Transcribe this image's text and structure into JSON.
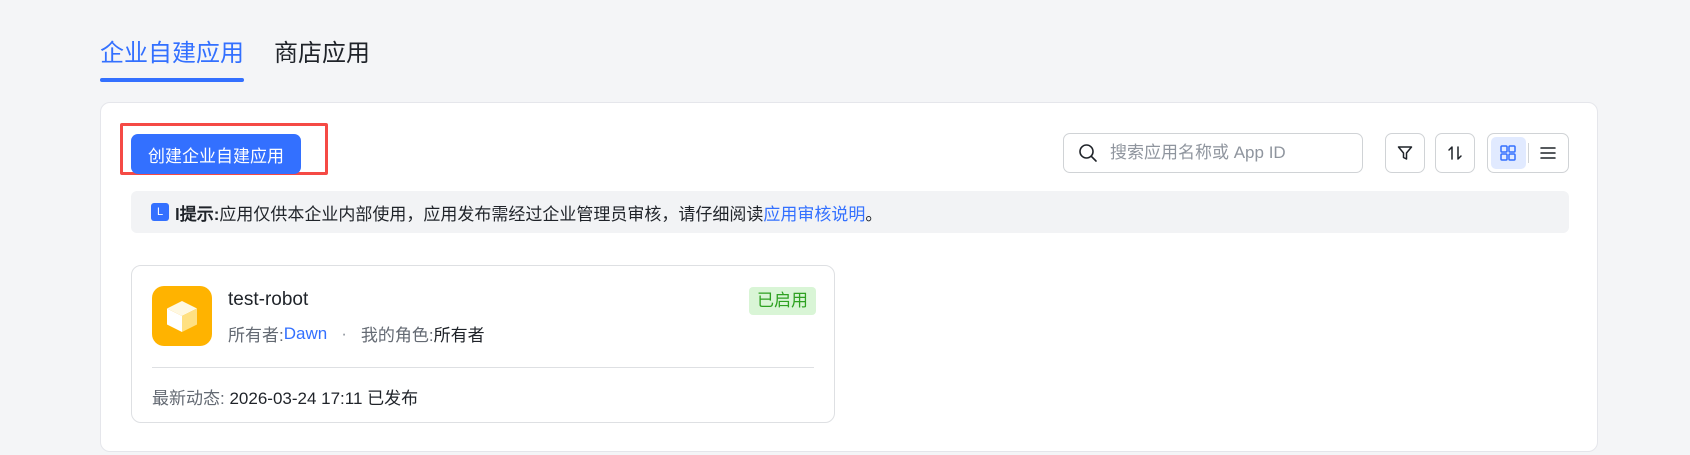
{
  "tabs": [
    {
      "label": "企业自建应用",
      "active": true
    },
    {
      "label": "商店应用",
      "active": false
    }
  ],
  "toolbar": {
    "create_label": "创建企业自建应用",
    "search_placeholder": "搜索应用名称或 App ID",
    "filter_icon": "filter-icon",
    "sort_icon": "sort-icon",
    "grid_view_icon": "grid-view-icon",
    "list_view_icon": "list-view-icon"
  },
  "notice": {
    "icon_text": "L",
    "title": "l提示:",
    "text": " 应用仅供本企业内部使用，应用发布需经过企业管理员审核，请仔细阅读 ",
    "link": "应用审核说明",
    "end": "。"
  },
  "apps": [
    {
      "name": "test-robot",
      "owner_label": "所有者:",
      "owner": "Dawn",
      "separator": "·",
      "role_label": "我的角色:",
      "role": "所有者",
      "status": "已启用",
      "activity_label": "最新动态:",
      "activity": "2026-03-24 17:11 已发布",
      "logo_icon": "cube-icon"
    }
  ],
  "colors": {
    "accent": "#3370ff",
    "highlight": "#f54a45",
    "status_bg": "#d9f5d6",
    "status_text": "#2ea121",
    "logo_bg": "#ffb300"
  }
}
